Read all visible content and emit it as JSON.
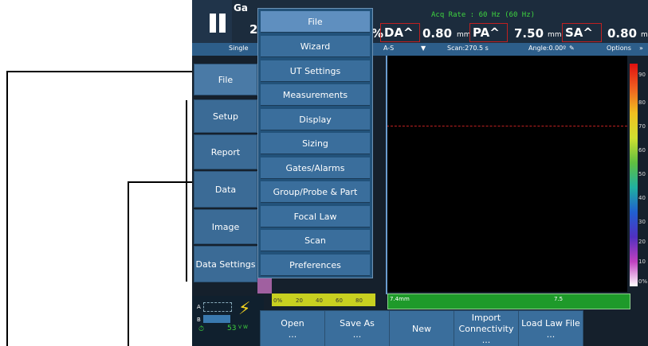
{
  "topbar": {
    "gate_label": "Ga",
    "gate_value": "2",
    "acq_rate": "Acq Rate : 60 Hz (60 Hz)",
    "pct": "%",
    "readings": [
      {
        "label": "DA^",
        "value": "0.80",
        "unit": "mm"
      },
      {
        "label": "PA^",
        "value": "7.50",
        "unit": "mm"
      },
      {
        "label": "SA^",
        "value": "0.80",
        "unit": "mm"
      }
    ]
  },
  "status": {
    "mode": "Single",
    "view": "A-S",
    "scan": "Scan:270.5 s",
    "angle": "Angle:0.00º",
    "options": "Options"
  },
  "side_menu": [
    "File",
    "Setup",
    "Report",
    "Data",
    "Image",
    "Data Settings"
  ],
  "file_menu": [
    "File",
    "Wizard",
    "UT Settings",
    "Measurements",
    "Display",
    "Sizing",
    "Gates/Alarms",
    "Group/Probe & Part",
    "Focal Law",
    "Scan",
    "Preferences"
  ],
  "plot": {
    "ruler_label": "7.4mm",
    "ruler_mark": "7.5",
    "pct_ticks": [
      "0%",
      "20",
      "40",
      "60",
      "80"
    ],
    "colorbar_ticks": [
      "90",
      "80",
      "70",
      "60",
      "50",
      "40",
      "30",
      "20",
      "10",
      "0%"
    ]
  },
  "status_icons": {
    "a": "A",
    "b": "B",
    "battery": "53",
    "vw": "V W"
  },
  "bottom_buttons": [
    {
      "label": "Open",
      "sub": "..."
    },
    {
      "label": "Save As",
      "sub": "..."
    },
    {
      "label": "New",
      "sub": ""
    },
    {
      "label": "Import Connectivity",
      "sub": "..."
    },
    {
      "label": "Load Law File",
      "sub": "..."
    }
  ]
}
